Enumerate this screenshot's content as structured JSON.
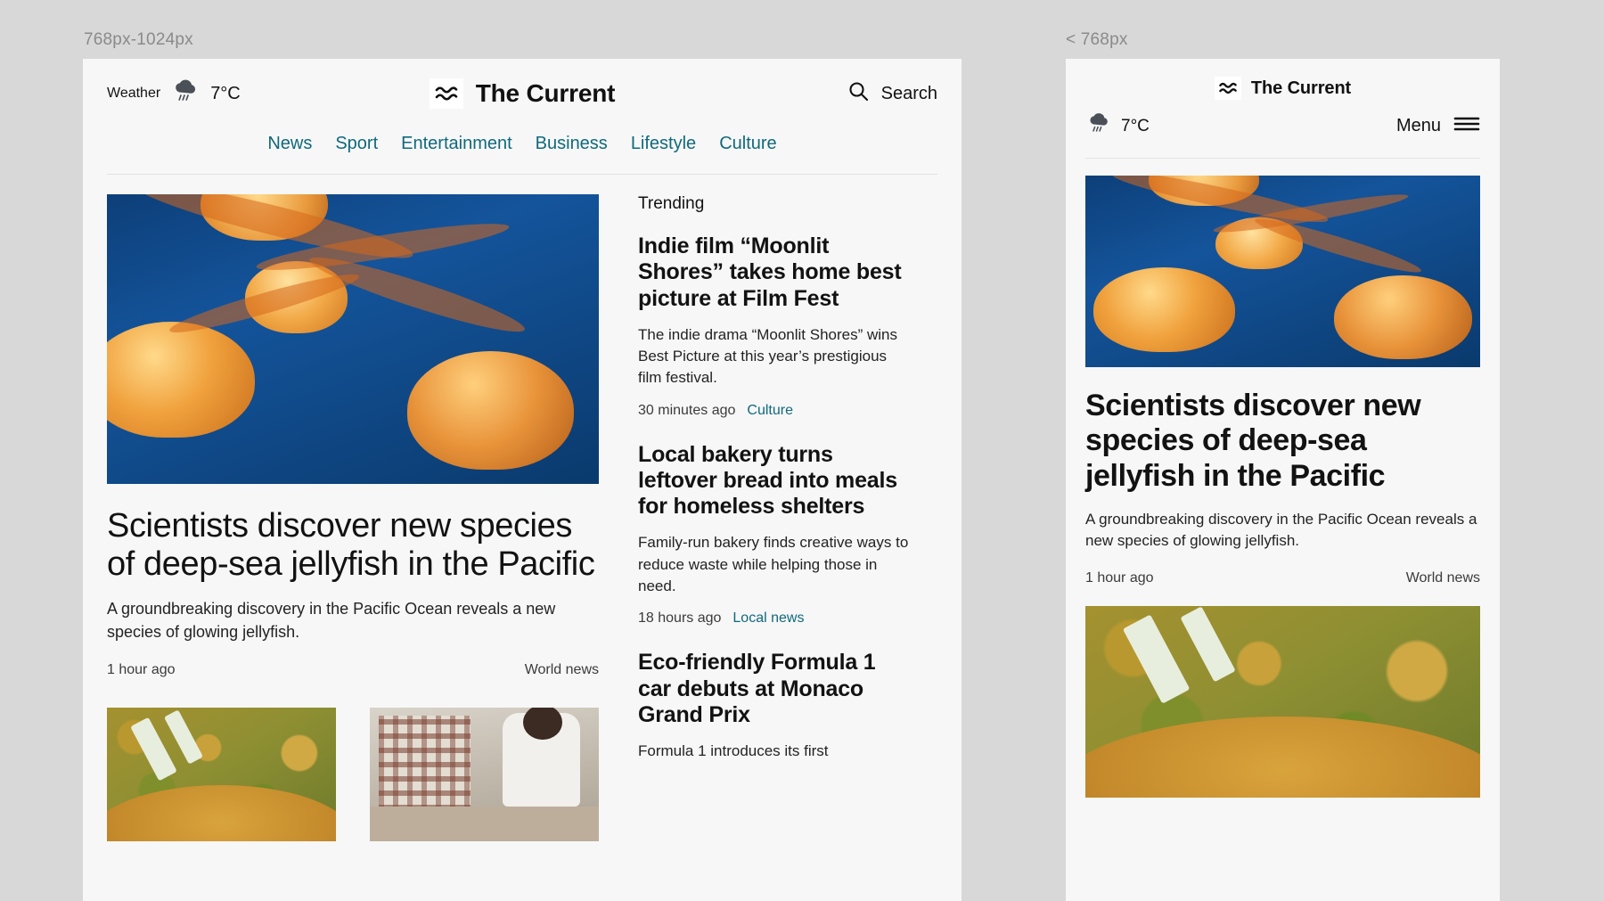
{
  "breakpoints": {
    "tablet_label": "768px-1024px",
    "mobile_label": "< 768px"
  },
  "brand": {
    "name": "The Current",
    "logo_icon": "wave-logo-icon"
  },
  "tablet": {
    "header": {
      "weather_label": "Weather",
      "weather_icon": "rain-cloud-icon",
      "temperature": "7°C",
      "search_label": "Search",
      "search_icon": "search-icon"
    },
    "nav": [
      {
        "label": "News"
      },
      {
        "label": "Sport"
      },
      {
        "label": "Entertainment"
      },
      {
        "label": "Business"
      },
      {
        "label": "Lifestyle"
      },
      {
        "label": "Culture"
      }
    ],
    "lead": {
      "image_alt": "jellyfish-photo",
      "headline": "Scientists discover new species of deep-sea jellyfish in the Pacific",
      "standfirst": "A groundbreaking discovery in the Pacific Ocean reveals a new species of glowing jellyfish.",
      "time": "1 hour ago",
      "category": "World news"
    },
    "thumbnails": [
      {
        "alt": "pasta-photo"
      },
      {
        "alt": "bakery-kitchen-photo"
      }
    ],
    "sidebar": {
      "kicker": "Trending",
      "items": [
        {
          "headline": "Indie film “Moonlit Shores” takes home best picture at Film Fest",
          "standfirst": "The indie drama “Moonlit Shores” wins Best Picture at this year’s prestigious film festival.",
          "time": "30 minutes ago",
          "category": "Culture"
        },
        {
          "headline": "Local bakery turns leftover bread into meals for homeless shelters",
          "standfirst": "Family-run bakery finds creative ways to reduce waste while helping those in need.",
          "time": "18 hours ago",
          "category": "Local news"
        },
        {
          "headline": "Eco-friendly Formula 1 car debuts at Monaco Grand Prix",
          "standfirst": "Formula 1 introduces its first",
          "time": "",
          "category": ""
        }
      ]
    }
  },
  "mobile": {
    "header": {
      "weather_icon": "rain-cloud-icon",
      "temperature": "7°C",
      "menu_label": "Menu",
      "menu_icon": "hamburger-icon"
    },
    "lead": {
      "image_alt": "jellyfish-photo",
      "headline": "Scientists discover new species of deep-sea jellyfish in the Pacific",
      "standfirst": "A groundbreaking discovery in the Pacific Ocean reveals a new species of glowing jellyfish.",
      "time": "1 hour ago",
      "category": "World news"
    },
    "next_thumbnail": {
      "alt": "pasta-photo"
    }
  },
  "colors": {
    "page_bg": "#d8d8d8",
    "surface": "#f7f7f7",
    "link": "#10697c",
    "text": "#121212",
    "muted": "#8a8a8a"
  }
}
